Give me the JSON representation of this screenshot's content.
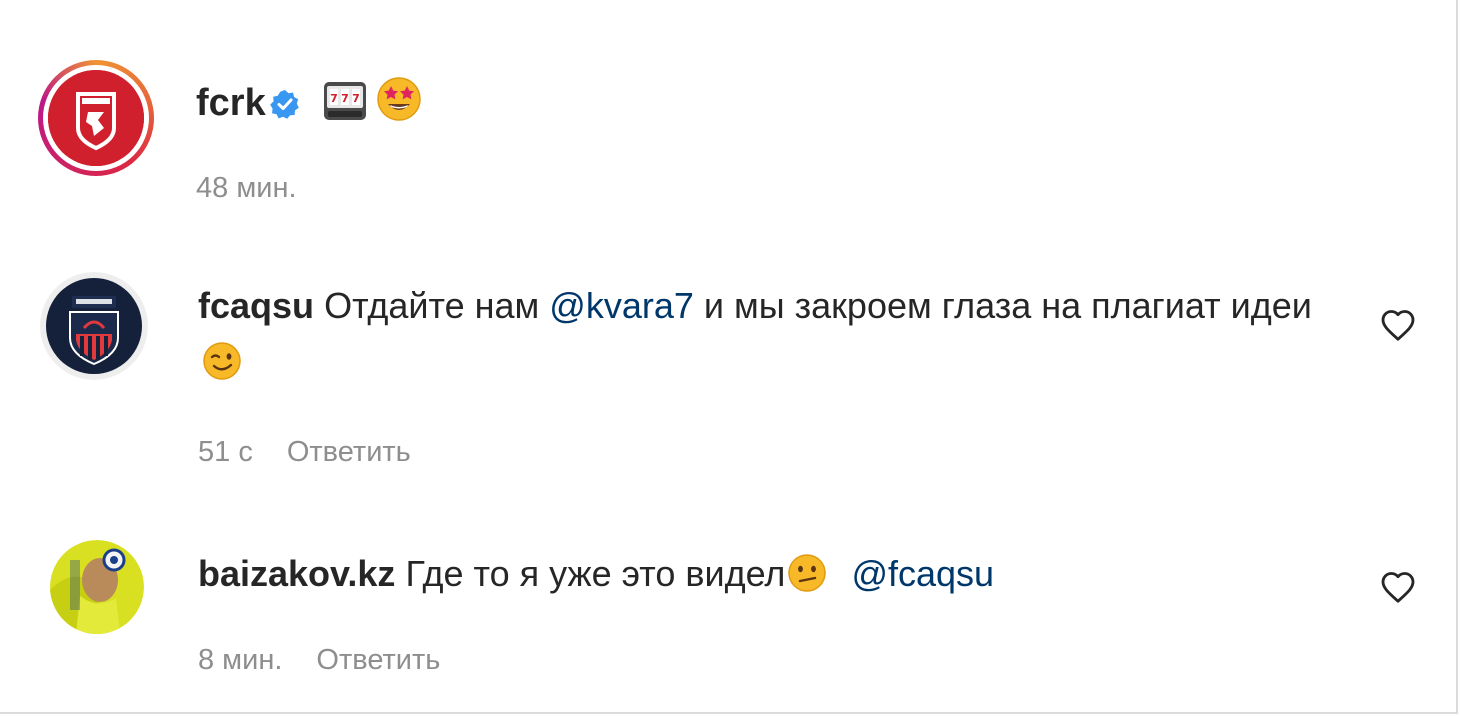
{
  "caption": {
    "username": "fcrk",
    "time": "48 мин."
  },
  "comments": [
    {
      "username": "fcaqsu",
      "text_before": "Отдайте нам",
      "mention": "@kvara7",
      "text_after": "и мы закроем глаза на плагиат идеи",
      "time": "51 с",
      "reply_label": "Ответить"
    },
    {
      "username": "baizakov.kz",
      "text_before": "Где то я уже это видел",
      "mention": "@fcaqsu",
      "time": "8 мин.",
      "reply_label": "Ответить"
    }
  ],
  "icons": {
    "verified": "verified-badge-icon",
    "slot_machine": "slot-machine-emoji",
    "star_eyes": "star-struck-emoji",
    "wink": "winking-face-emoji",
    "confused": "confused-face-emoji",
    "like": "heart-outline-icon"
  },
  "colors": {
    "text": "#262626",
    "secondary": "#8e8e8e",
    "mention": "#00376b",
    "verified": "#3897f0",
    "fcrk_red": "#d0202e"
  }
}
